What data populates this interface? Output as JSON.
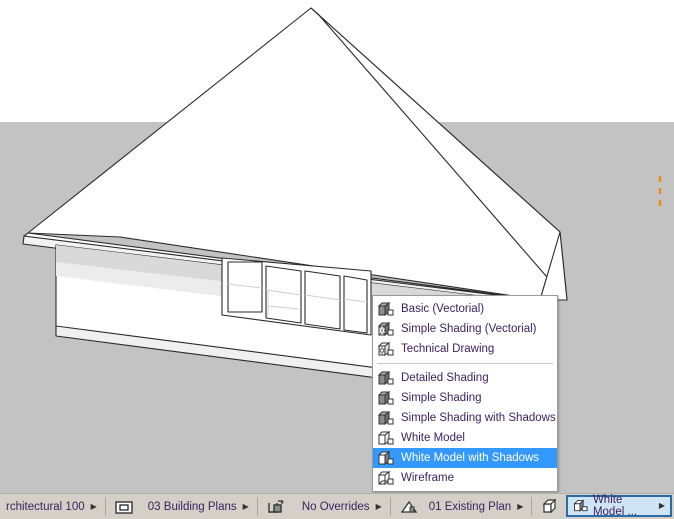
{
  "viewport": {
    "name": "3d-model-viewport",
    "background_sky": "#ffffff",
    "background_ground": "#c3c3c3",
    "model_fill": "#ffffff",
    "model_shade": "#d9d9d9",
    "model_shade_dark": "#c9c9c9",
    "line_color": "#2b2b2b",
    "marker_color": "#f08a1e",
    "description": "Perspective view of a white hip-roof building model with a band of four windows"
  },
  "context_menu": {
    "name": "render-style-menu",
    "groups": [
      {
        "items": [
          {
            "label": "Basic (Vectorial)",
            "icon": "cube-solid-icon",
            "selected": false
          },
          {
            "label": "Simple Shading (Vectorial)",
            "icon": "cube-brick-icon",
            "selected": false
          },
          {
            "label": "Technical Drawing",
            "icon": "cube-brick-outline-icon",
            "selected": false
          }
        ]
      },
      {
        "items": [
          {
            "label": "Detailed Shading",
            "icon": "cube-solid-icon",
            "selected": false
          },
          {
            "label": "Simple Shading",
            "icon": "cube-solid-icon",
            "selected": false
          },
          {
            "label": "Simple Shading with Shadows",
            "icon": "cube-solid-icon",
            "selected": false
          },
          {
            "label": "White Model",
            "icon": "cube-white-icon",
            "selected": false
          },
          {
            "label": "White Model with Shadows",
            "icon": "cube-shadow-icon",
            "selected": true
          },
          {
            "label": "Wireframe",
            "icon": "cube-wireframe-icon",
            "selected": false
          }
        ]
      }
    ],
    "highlight_color": "#3399ff",
    "text_color": "#3b1f5e"
  },
  "statusbar": {
    "name": "bottom-status-bar",
    "scale": {
      "label": "rchitectural 100",
      "arrow": "▶"
    },
    "layer_combination": {
      "icon": "layer-box-icon",
      "label": "03 Building Plans",
      "arrow": "▶"
    },
    "pen_set": {
      "icon": "pen-override-icon",
      "label": "No Overrides",
      "arrow": "▶"
    },
    "model_view": {
      "icon": "house-icon",
      "label": "01 Existing Plan",
      "arrow": "▶"
    },
    "renovation": {
      "icon": "wire-cube-icon"
    },
    "render_style": {
      "icon": "cube-shadow-icon",
      "label": "White Model ...",
      "arrow": "▶",
      "active": true
    },
    "background": "#d4d0c8",
    "text_color": "#3b1f5e",
    "active_border": "#2a6ca8"
  }
}
